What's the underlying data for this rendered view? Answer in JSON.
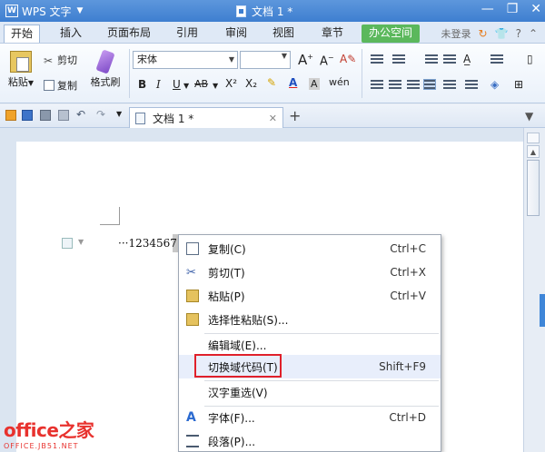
{
  "app": {
    "logo_text": "WPS 文字",
    "doc_title": "文档 1 *"
  },
  "menu_tabs": [
    {
      "label": "开始",
      "active": true
    },
    {
      "label": "插入"
    },
    {
      "label": "页面布局"
    },
    {
      "label": "引用"
    },
    {
      "label": "审阅"
    },
    {
      "label": "视图"
    },
    {
      "label": "章节"
    },
    {
      "label": "办公空间",
      "accent": "#5bb85c"
    }
  ],
  "account": {
    "label": "未登录"
  },
  "ribbon": {
    "paste_label": "粘贴",
    "cut_label": "剪切",
    "copy_label": "复制",
    "format_painter_label": "格式刷",
    "font_name": "宋体",
    "font_size": "",
    "bold": "B",
    "italic": "I",
    "underline": "U",
    "strike": "AB",
    "superscript": "X²",
    "subscript": "X₂",
    "font_color": "A",
    "char_shading": "A"
  },
  "doc_tab": {
    "label": "文档 1 *"
  },
  "document": {
    "field_text": "···1234567"
  },
  "context_menu": {
    "items": [
      {
        "label": "复制(C)",
        "shortcut": "Ctrl+C",
        "icon": "copy-icon"
      },
      {
        "label": "剪切(T)",
        "shortcut": "Ctrl+X",
        "icon": "cut-icon"
      },
      {
        "label": "粘贴(P)",
        "shortcut": "Ctrl+V",
        "icon": "paste-icon"
      },
      {
        "label": "选择性粘贴(S)...",
        "shortcut": "",
        "icon": "paste-special-icon"
      },
      {
        "label": "编辑域(E)...",
        "shortcut": "",
        "icon": ""
      },
      {
        "label": "切换域代码(T)",
        "shortcut": "Shift+F9",
        "icon": "",
        "highlighted": true
      },
      {
        "label": "汉字重选(V)",
        "shortcut": "",
        "icon": ""
      },
      {
        "label": "字体(F)...",
        "shortcut": "Ctrl+D",
        "icon": "font-icon"
      },
      {
        "label": "段落(P)...",
        "shortcut": "",
        "icon": "paragraph-icon"
      }
    ]
  },
  "watermark": {
    "main": "office之家",
    "sub": "OFFICE.JB51.NET"
  },
  "colors": {
    "title_bar": "#3e7fd0",
    "highlight_box": "#e0202a",
    "office_tab": "#5bb85c"
  }
}
